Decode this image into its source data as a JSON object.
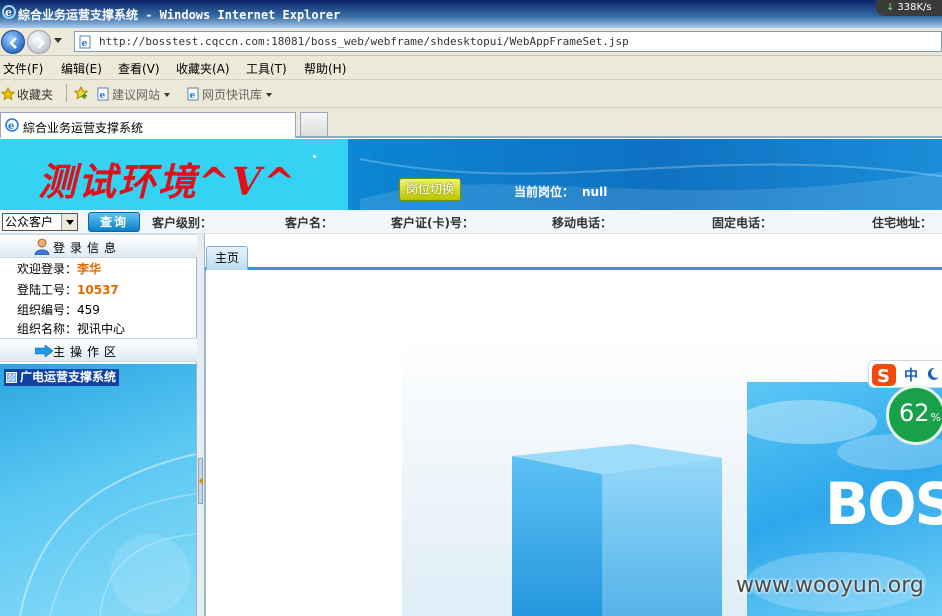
{
  "window": {
    "title": "綜合业务运营支撑系统 - Windows Internet Explorer",
    "net_speed": "338K/s"
  },
  "address_bar": {
    "url": "http://bosstest.cqccn.com:18081/boss_web/webframe/shdesktopui/WebAppFrameSet.jsp"
  },
  "menu": {
    "items": [
      "文件(F)",
      "编辑(E)",
      "查看(V)",
      "收藏夹(A)",
      "工具(T)",
      "帮助(H)"
    ]
  },
  "favorites_bar": {
    "favorites_label": "收藏夹",
    "suggested_sites": "建议网站",
    "web_slice": "网页快讯库"
  },
  "browser_tab": {
    "label": "綜合业务运营支撑系统"
  },
  "app": {
    "logo_text": "测试环境^V^",
    "role_switch_label": "岗位切换",
    "current_role_label": "当前岗位：",
    "current_role_value": "null"
  },
  "search": {
    "customer_type": "公众客户",
    "query_label": "查询",
    "fields": [
      "客户级别：",
      "客户名：",
      "客户证(卡)号：",
      "移动电话：",
      "固定电话：",
      "住宅地址："
    ]
  },
  "login_info": {
    "header": "登录信息",
    "welcome_label": "欢迎登录：",
    "welcome_value": "李华",
    "login_id_label": "登陆工号：",
    "login_id_value": "10537",
    "org_id_label": "组织编号：",
    "org_id_value": "459",
    "org_name_label": "组织名称：",
    "org_name_value": "视讯中心"
  },
  "operations": {
    "header": "主操作区",
    "tree_root": "广电运营支撑系统"
  },
  "main": {
    "tabs": [
      {
        "label": "主页"
      }
    ],
    "banner_text": "BOS"
  },
  "overlays": {
    "ime_mode": "中",
    "battery_value": "62",
    "battery_unit": "%",
    "watermark": "www.wooyun.org"
  },
  "colors": {
    "accent_blue": "#0b84d2",
    "logo_red": "#e0101a",
    "value_orange": "#e06b00"
  },
  "icons": [
    "ie-logo-icon",
    "back-arrow-icon",
    "forward-arrow-icon",
    "page-icon",
    "favorites-star-icon",
    "add-favorite-icon",
    "user-icon",
    "arrow-right-icon",
    "folder-icon",
    "sogou-icon",
    "moon-icon"
  ]
}
